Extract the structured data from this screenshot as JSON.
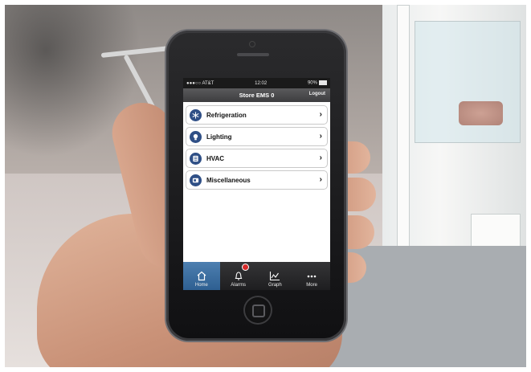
{
  "status_bar": {
    "carrier": "●●●○○ AT&T",
    "time": "12:02",
    "battery": "90%"
  },
  "nav_bar": {
    "title": "Store EMS 0",
    "logout_label": "Logout"
  },
  "menu": {
    "items": [
      {
        "label": "Refrigeration",
        "icon": "snowflake-icon"
      },
      {
        "label": "Lighting",
        "icon": "lightbulb-icon"
      },
      {
        "label": "HVAC",
        "icon": "hvac-icon"
      },
      {
        "label": "Miscellaneous",
        "icon": "misc-icon"
      }
    ]
  },
  "tab_bar": {
    "tabs": [
      {
        "label": "Home",
        "icon": "home-icon",
        "active": true
      },
      {
        "label": "Alarms",
        "icon": "bell-icon",
        "has_badge": true
      },
      {
        "label": "Graph",
        "icon": "graph-icon"
      },
      {
        "label": "More",
        "icon": "more-icon"
      }
    ]
  },
  "colors": {
    "nav_bar": "#3d3d3f",
    "tab_bar": "#1e1e20",
    "active_tab": "#2e5f91",
    "menu_icon": "#2f4f86",
    "alarm_badge": "#d62a2a"
  }
}
